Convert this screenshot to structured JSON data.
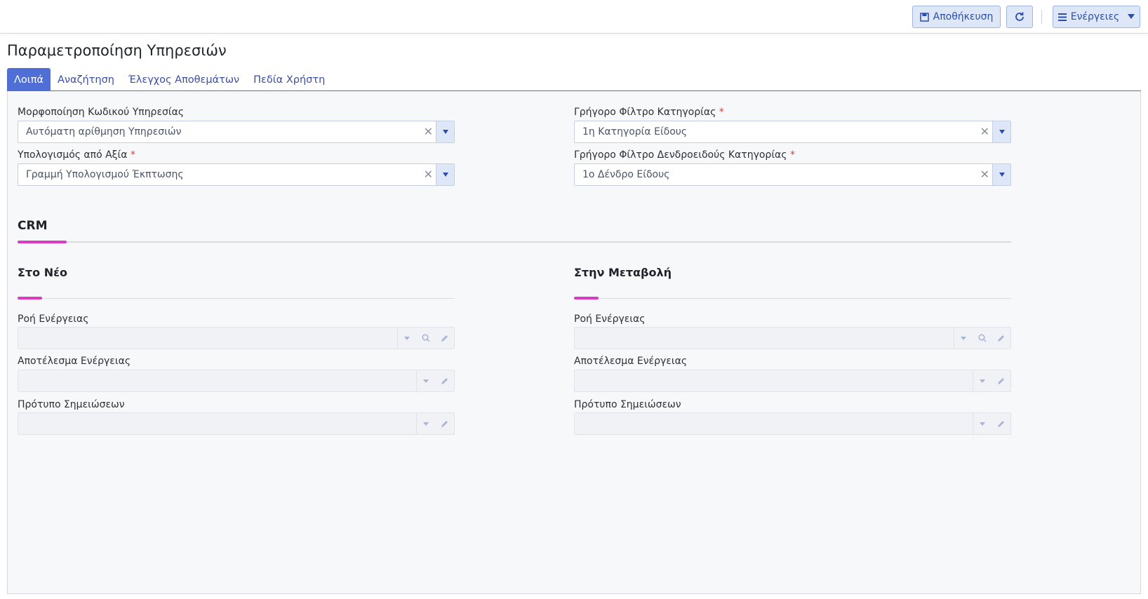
{
  "toolbar": {
    "save_label": "Αποθήκευση",
    "actions_label": "Ενέργειες"
  },
  "page": {
    "title": "Παραμετροποίηση Υπηρεσιών"
  },
  "tabs": [
    {
      "label": "Λοιπά",
      "active": true
    },
    {
      "label": "Αναζήτηση",
      "active": false
    },
    {
      "label": "Έλεγχος Αποθεμάτων",
      "active": false
    },
    {
      "label": "Πεδία Χρήστη",
      "active": false
    }
  ],
  "general": {
    "code_format": {
      "label": "Μορφοποίηση Κωδικού Υπηρεσίας",
      "value": "Αυτόματη αρίθμηση Υπηρεσιών"
    },
    "calc_from_value": {
      "label": "Υπολογισμός από Αξία",
      "value": "Γραμμή Υπολογισμού Έκπτωσης",
      "required": true
    },
    "quick_category": {
      "label": "Γρήγορο Φίλτρο Κατηγορίας",
      "value": "1η Κατηγορία Είδους",
      "required": true
    },
    "quick_tree_category": {
      "label": "Γρήγορο Φίλτρο Δενδροειδούς Κατηγορίας",
      "value": "1ο Δένδρο Είδους",
      "required": true
    },
    "required_mark": "*"
  },
  "crm": {
    "title": "CRM",
    "on_new": {
      "title": "Στο Νέο",
      "action_flow_label": "Ροή Ενέργειας",
      "action_result_label": "Αποτέλεσμα Ενέργειας",
      "notes_template_label": "Πρότυπο Σημειώσεων"
    },
    "on_change": {
      "title": "Στην Μεταβολή",
      "action_flow_label": "Ροή Ενέργειας",
      "action_result_label": "Αποτέλεσμα Ενέργειας",
      "notes_template_label": "Πρότυπο Σημειώσεων"
    }
  },
  "colors": {
    "primary": "#4f6fd6",
    "accent": "#d93cc0",
    "required": "#e0403a"
  },
  "icons": {
    "save": "floppy-icon",
    "refresh": "refresh-icon",
    "actions": "menu-icon",
    "dropdown": "caret-down-icon",
    "clear": "close-icon",
    "search": "search-icon",
    "edit": "pencil-icon"
  }
}
